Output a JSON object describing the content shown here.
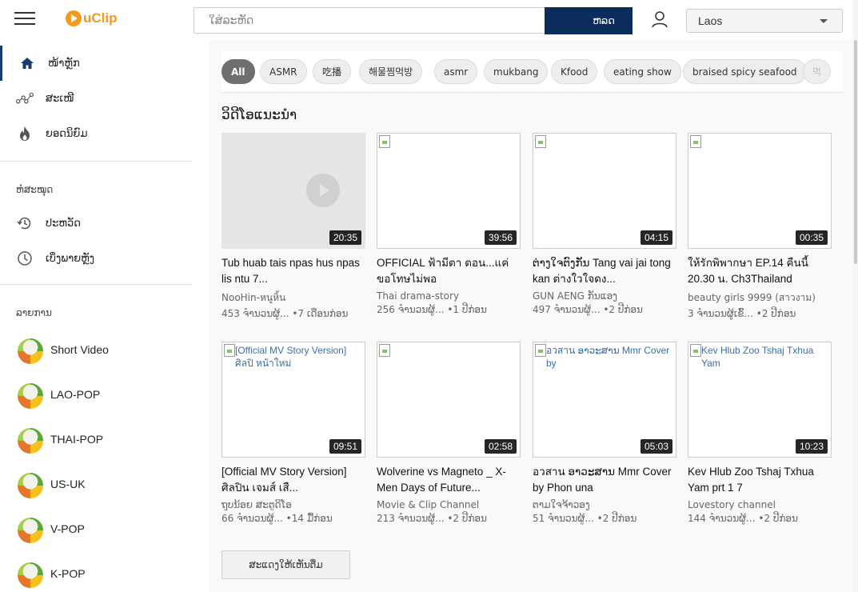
{
  "header": {
    "logo_text": "uClip",
    "search_placeholder": "ໃສ່ລະຫັດ",
    "search_button": "ຫລດ",
    "language": "Laos"
  },
  "sidebar": {
    "nav": [
      {
        "label": "ໜ້າຫຼັກ",
        "icon": "home-icon",
        "active": true
      },
      {
        "label": "ສະເໜີ",
        "icon": "share-icon"
      },
      {
        "label": "ຍອດນິຍົມ",
        "icon": "fire-icon"
      }
    ],
    "library_title": "ຫໍສະໝຸດ",
    "library": [
      {
        "label": "ປະຫວັດ",
        "icon": "history-icon"
      },
      {
        "label": "ເບິ່ງພາຍຫຼັງ",
        "icon": "clock-icon"
      }
    ],
    "genres_title": "ລາຍການ",
    "genres": [
      "Short Video",
      "LAO-POP",
      "THAI-POP",
      "US-UK",
      "V-POP",
      "K-POP"
    ]
  },
  "chips": [
    "All",
    "ASMR",
    "吃播",
    "해물찜먹방",
    "asmr",
    "mukbang",
    "Kfood",
    "eating show",
    "braised spicy seafood",
    "먹"
  ],
  "section_heading": "ວິດີໂອແນະນຳ",
  "videos": [
    {
      "title": "Tub huab tais npas hus npas lis ntu 7...",
      "channel": "NooHin-หนูหิ้น",
      "meta": "453 ຈຳນວນຜູ້... •7 ເດືອນກ່ອນ",
      "duration": "20:35",
      "alt": ""
    },
    {
      "title": "OFFICIAL ฟ้ามีตา ตอน...แค่ขอโทษไม่พอ",
      "channel": "Thai drama-story",
      "meta": "256 ຈຳນວນຜູ້... •1 ປີກ່ອນ",
      "duration": "39:56",
      "alt": ""
    },
    {
      "title": "ຕ່າງໃຈຕົງກັນ Tang vai jai tong kan ต่างใวใจดง...",
      "channel": "GUN AENG ກັນແອງ",
      "meta": "497 ຈຳນວນຜູ້... •2 ປີກ່ອນ",
      "duration": "04:15",
      "alt": ""
    },
    {
      "title": "ให้รักพิพากษา EP.14 คืนนี้ 20.30 น. Ch3Thailand",
      "channel": "beauty girls 9999 (สาวงาม)",
      "meta": "3 ຈຳນວນຜູ້ເຂົ້... •2 ປີກ່ອນ",
      "duration": "00:35",
      "alt": ""
    },
    {
      "title": "[Official MV Story Version] ศิลปิน เจมส์ เสื...",
      "channel": "ຖຸບນ້ອຍ ສະຕູດິໂອ",
      "meta": "66 ຈຳນວນຜູ້... •14 ມື້ກ່ອນ",
      "duration": "09:51",
      "alt": "[Official MV Story Version] ศิลปิ หน้าใหม่"
    },
    {
      "title": "Wolverine vs Magneto _ X-Men Days of Future...",
      "channel": "Movie & Clip Channel",
      "meta": "213 ຈຳນວນຜູ້... •2 ປີກ່ອນ",
      "duration": "02:58",
      "alt": ""
    },
    {
      "title": "อวสาน ອາວະສານ Mmr Cover by Phon una",
      "channel": "ຕາມໃຈຈ້າວອງ",
      "meta": "51 ຈຳນວນຜູ້... •2 ປີກ່ອນ",
      "duration": "05:03",
      "alt": "อวสาน ອາວະສານ Mmr Cover by"
    },
    {
      "title": "Kev Hlub Zoo Tshaj Txhua Yam prt 1 7",
      "channel": "Lovestory channel",
      "meta": "144 ຈຳນວນຜູ້... •2 ປີກ່ອນ",
      "duration": "10:23",
      "alt": "Kev Hlub Zoo Tshaj Txhua Yam"
    }
  ],
  "load_more": "ສະແດງໃຫ້ເຫັນຕື່ມ"
}
